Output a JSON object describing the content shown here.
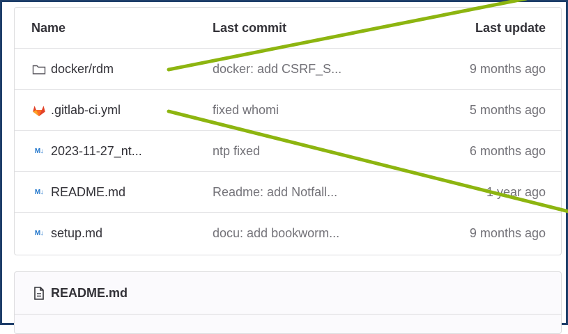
{
  "table": {
    "headers": {
      "name": "Name",
      "last_commit": "Last commit",
      "last_update": "Last update"
    },
    "rows": [
      {
        "icon": "folder-icon",
        "name": "docker/rdm",
        "commit": "docker: add CSRF_S...",
        "updated": "9 months ago"
      },
      {
        "icon": "gitlab-icon",
        "name": ".gitlab-ci.yml",
        "commit": "fixed whomi",
        "updated": "5 months ago"
      },
      {
        "icon": "markdown-icon",
        "name": "2023-11-27_nt...",
        "commit": "ntp fixed",
        "updated": "6 months ago"
      },
      {
        "icon": "markdown-icon",
        "name": "README.md",
        "commit": "Readme: add Notfall...",
        "updated": "1 year ago"
      },
      {
        "icon": "markdown-icon",
        "name": "setup.md",
        "commit": "docu: add bookworm...",
        "updated": "9 months ago"
      }
    ]
  },
  "markdown_icon_text": "M↓",
  "readme": {
    "title": "README.md",
    "icon": "file-text-icon"
  },
  "colors": {
    "annotation_line": "#8db510",
    "frame_border": "#1f3f6a",
    "markdown_icon": "#1f75cb",
    "gitlab_orange": "#e24329"
  }
}
